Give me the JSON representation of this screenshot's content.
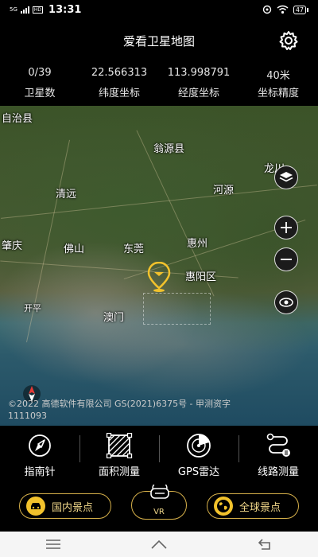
{
  "status": {
    "signal": "5G",
    "hd": "HD",
    "time": "13:31",
    "battery": "47"
  },
  "header": {
    "title": "爱看卫星地图"
  },
  "stats": [
    {
      "value": "0/39",
      "label": "卫星数"
    },
    {
      "value": "22.566313",
      "label": "纬度坐标"
    },
    {
      "value": "113.998791",
      "label": "经度坐标"
    },
    {
      "value": "40米",
      "label": "坐标精度"
    }
  ],
  "map": {
    "labels": {
      "zigao": "自治县",
      "wengyuan": "翁源县",
      "longchuan": "龙川",
      "qingyuan": "清远",
      "heyuan": "河源",
      "zhaoqing": "肇庆",
      "foshan": "佛山",
      "dongguan": "东莞",
      "huizhou": "惠州",
      "huiyang": "惠阳区",
      "kaiping": "开平",
      "macau": "澳门"
    },
    "copyright_line1": "©2022 高德软件有限公司 GS(2021)6375号 - 甲测资字",
    "copyright_line2": "1111093"
  },
  "tools": [
    {
      "label": "指南针",
      "icon": "compass-icon"
    },
    {
      "label": "面积测量",
      "icon": "area-measure-icon"
    },
    {
      "label": "GPS雷达",
      "icon": "radar-icon"
    },
    {
      "label": "线路测量",
      "icon": "route-measure-icon"
    }
  ],
  "bottom": {
    "domestic": "国内景点",
    "vr": "VR",
    "global": "全球景点"
  },
  "colors": {
    "accent_gold": "#f2c22c",
    "background": "#000000"
  }
}
